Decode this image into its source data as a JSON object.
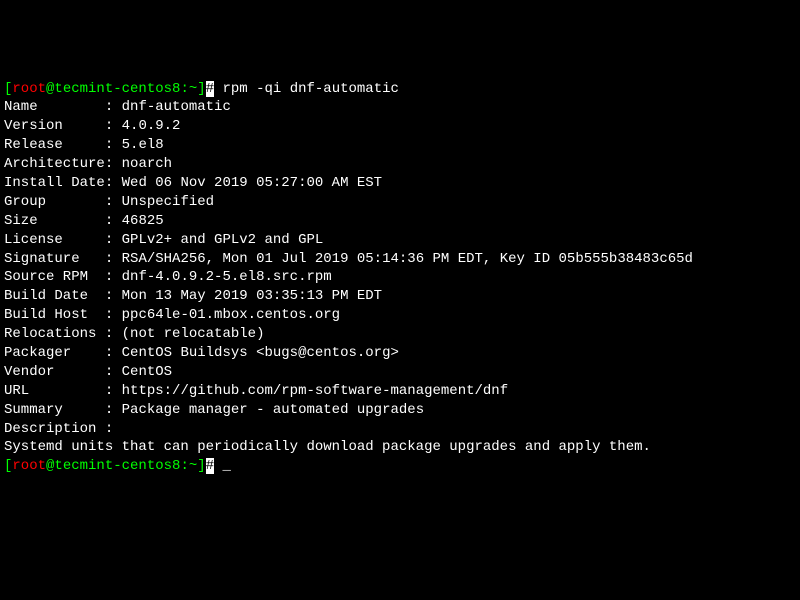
{
  "prompt1": {
    "bracket_open": "[",
    "user": "root",
    "at": "@",
    "host": "tecmint-centos8",
    "colon": ":",
    "path": "~",
    "bracket_close": "]",
    "hash": "#",
    "command": " rpm -qi dnf-automatic"
  },
  "fields": [
    {
      "label": "Name        ",
      "sep": ": ",
      "value": "dnf-automatic"
    },
    {
      "label": "Version     ",
      "sep": ": ",
      "value": "4.0.9.2"
    },
    {
      "label": "Release     ",
      "sep": ": ",
      "value": "5.el8"
    },
    {
      "label": "Architecture",
      "sep": ": ",
      "value": "noarch"
    },
    {
      "label": "Install Date",
      "sep": ": ",
      "value": "Wed 06 Nov 2019 05:27:00 AM EST"
    },
    {
      "label": "Group       ",
      "sep": ": ",
      "value": "Unspecified"
    },
    {
      "label": "Size        ",
      "sep": ": ",
      "value": "46825"
    },
    {
      "label": "License     ",
      "sep": ": ",
      "value": "GPLv2+ and GPLv2 and GPL"
    },
    {
      "label": "Signature   ",
      "sep": ": ",
      "value": "RSA/SHA256, Mon 01 Jul 2019 05:14:36 PM EDT, Key ID 05b555b38483c65d"
    },
    {
      "label": "Source RPM  ",
      "sep": ": ",
      "value": "dnf-4.0.9.2-5.el8.src.rpm"
    },
    {
      "label": "Build Date  ",
      "sep": ": ",
      "value": "Mon 13 May 2019 03:35:13 PM EDT"
    },
    {
      "label": "Build Host  ",
      "sep": ": ",
      "value": "ppc64le-01.mbox.centos.org"
    },
    {
      "label": "Relocations ",
      "sep": ": ",
      "value": "(not relocatable)"
    },
    {
      "label": "Packager    ",
      "sep": ": ",
      "value": "CentOS Buildsys <bugs@centos.org>"
    },
    {
      "label": "Vendor      ",
      "sep": ": ",
      "value": "CentOS"
    },
    {
      "label": "URL         ",
      "sep": ": ",
      "value": "https://github.com/rpm-software-management/dnf"
    },
    {
      "label": "Summary     ",
      "sep": ": ",
      "value": "Package manager - automated upgrades"
    },
    {
      "label": "Description ",
      "sep": ":",
      "value": ""
    }
  ],
  "description_body": "Systemd units that can periodically download package upgrades and apply them.",
  "prompt2": {
    "bracket_open": "[",
    "user": "root",
    "at": "@",
    "host": "tecmint-centos8",
    "colon": ":",
    "path": "~",
    "bracket_close": "]",
    "hash": "#"
  }
}
